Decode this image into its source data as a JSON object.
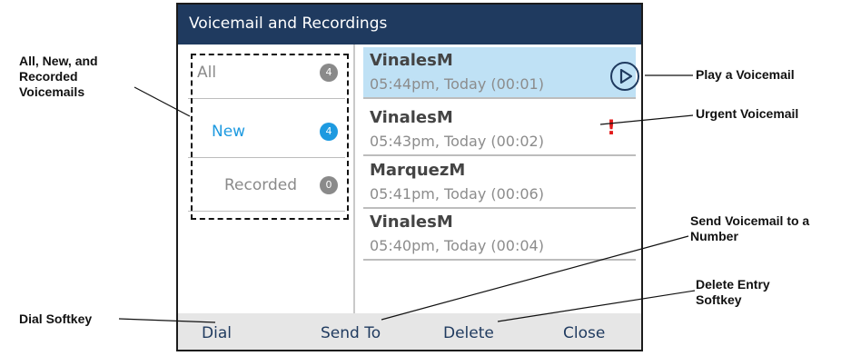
{
  "screen": {
    "title": "Voicemail and Recordings",
    "filters": [
      {
        "label": "All",
        "count": "4",
        "active": false
      },
      {
        "label": "New",
        "count": "4",
        "active": true
      },
      {
        "label": "Recorded",
        "count": "0",
        "active": false
      }
    ],
    "entries": [
      {
        "name": "VinalesM",
        "meta": "05:44pm, Today (00:01)",
        "selected": true,
        "status": "play"
      },
      {
        "name": "VinalesM",
        "meta": "05:43pm, Today (00:02)",
        "selected": false,
        "status": "urgent",
        "urgent_mark": "!"
      },
      {
        "name": "MarquezM",
        "meta": "05:41pm, Today (00:06)",
        "selected": false,
        "status": ""
      },
      {
        "name": "VinalesM",
        "meta": "05:40pm, Today (00:04)",
        "selected": false,
        "status": ""
      }
    ],
    "softkeys": [
      "Dial",
      "Send To",
      "Delete",
      "Close"
    ]
  },
  "callouts": {
    "filters": "All, New, and Recorded Voicemails",
    "play": "Play a Voicemail",
    "urgent": "Urgent Voicemail",
    "send": "Send Voicemail to a Number",
    "delete": "Delete Entry Softkey",
    "dial": "Dial Softkey"
  },
  "icons": {
    "play": "play-circle-icon",
    "urgent": "exclamation-icon"
  },
  "colors": {
    "title_bar": "#1f3a5f",
    "accent": "#1e9ae0",
    "selected_row": "#bfe1f5",
    "urgent": "#e21b1b"
  }
}
